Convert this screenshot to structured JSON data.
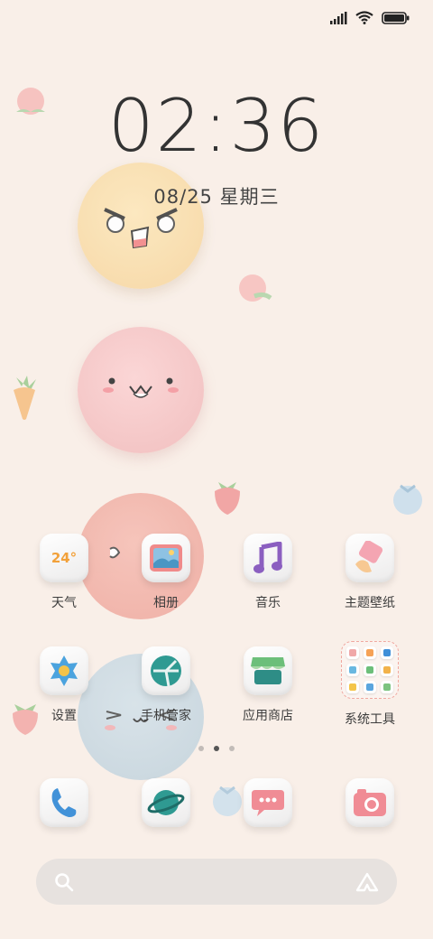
{
  "status_bar": {
    "icons": [
      "signal-icon",
      "wifi-icon",
      "battery-icon"
    ]
  },
  "lockscreen": {
    "time": "02:36",
    "date": "08/25 星期三"
  },
  "weather_widget": {
    "temperature": "24°"
  },
  "apps_row1": [
    {
      "label": "天气",
      "icon": "weather-icon"
    },
    {
      "label": "相册",
      "icon": "gallery-icon"
    },
    {
      "label": "音乐",
      "icon": "music-icon"
    },
    {
      "label": "主题壁纸",
      "icon": "theme-icon"
    }
  ],
  "apps_row2": [
    {
      "label": "设置",
      "icon": "settings-gear-icon"
    },
    {
      "label": "手机管家",
      "icon": "security-icon"
    },
    {
      "label": "应用商店",
      "icon": "app-store-icon"
    },
    {
      "label": "系统工具",
      "icon": "folder-icon"
    }
  ],
  "dock": [
    {
      "icon": "phone-icon"
    },
    {
      "icon": "browser-planet-icon"
    },
    {
      "icon": "messages-icon"
    },
    {
      "icon": "camera-icon"
    }
  ],
  "page_indicator": {
    "total": 3,
    "active": 2
  },
  "search_bar": {
    "icons": [
      "search-icon",
      "assistant-icon"
    ]
  },
  "colors": {
    "background": "#f9efe8",
    "accent_orange": "#f2a13a",
    "search_bg": "#e7e2df"
  }
}
